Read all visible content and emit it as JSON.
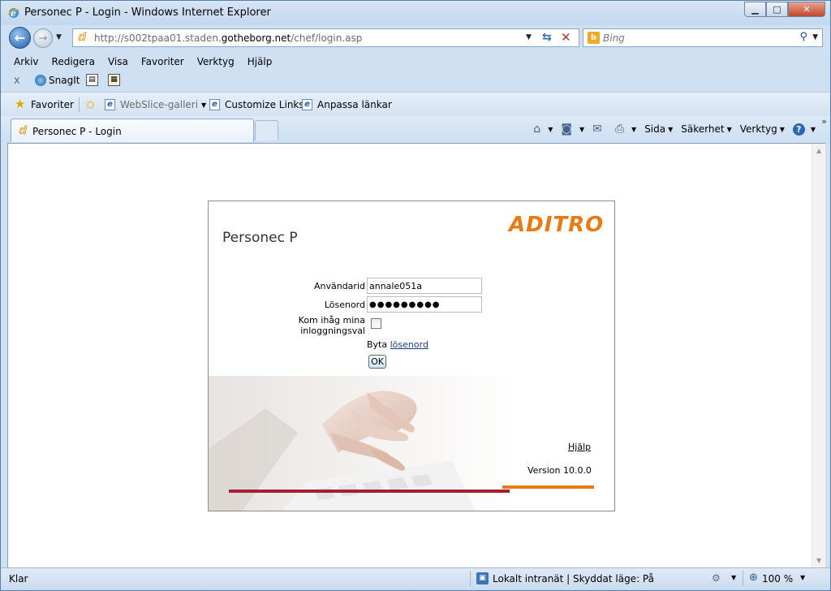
{
  "window": {
    "title": "Personec P - Login - Windows Internet Explorer",
    "minimize": "▁",
    "maximize": "□",
    "close": "✕"
  },
  "address": {
    "url_prefix": "http://s002tpaa01.staden.",
    "url_domain": "gotheborg.net",
    "url_suffix": "/chef/login.asp"
  },
  "search": {
    "placeholder": "Bing",
    "engine_letter": "b"
  },
  "menu": [
    "Arkiv",
    "Redigera",
    "Visa",
    "Favoriter",
    "Verktyg",
    "Hjälp"
  ],
  "snagit": {
    "label": "SnagIt"
  },
  "favorites": {
    "label": "Favoriter",
    "links": [
      {
        "label": "WebSlice-galleri",
        "has_dropdown": true,
        "dimmed": true
      },
      {
        "label": "Customize Links",
        "has_dropdown": false,
        "dimmed": false
      },
      {
        "label": "Anpassa länkar",
        "has_dropdown": false,
        "dimmed": false
      }
    ]
  },
  "tabs": {
    "active_label": "Personec P - Login"
  },
  "command_bar": {
    "page": "Sida",
    "safety": "Säkerhet",
    "tools": "Verktyg"
  },
  "login": {
    "app_title": "Personec P",
    "brand": "ADITRO",
    "username_label": "Användarid",
    "username_value": "annale051a",
    "password_label": "Lösenord",
    "password_value": "●●●●●●●●●",
    "remember_label_line1": "Kom ihåg mina",
    "remember_label_line2": "inloggningsval",
    "remember_checked": false,
    "change_prefix": "Byta",
    "change_link": "lösenord",
    "ok_label": "OK",
    "help_link": "Hjälp",
    "version": "Version 10.0.0"
  },
  "status": {
    "text": "Klar",
    "zone": "Lokalt intranät | Skyddat läge: På",
    "zoom": "100 %"
  },
  "colors": {
    "brand_orange": "#e67c13",
    "brand_red": "#a51e33"
  }
}
